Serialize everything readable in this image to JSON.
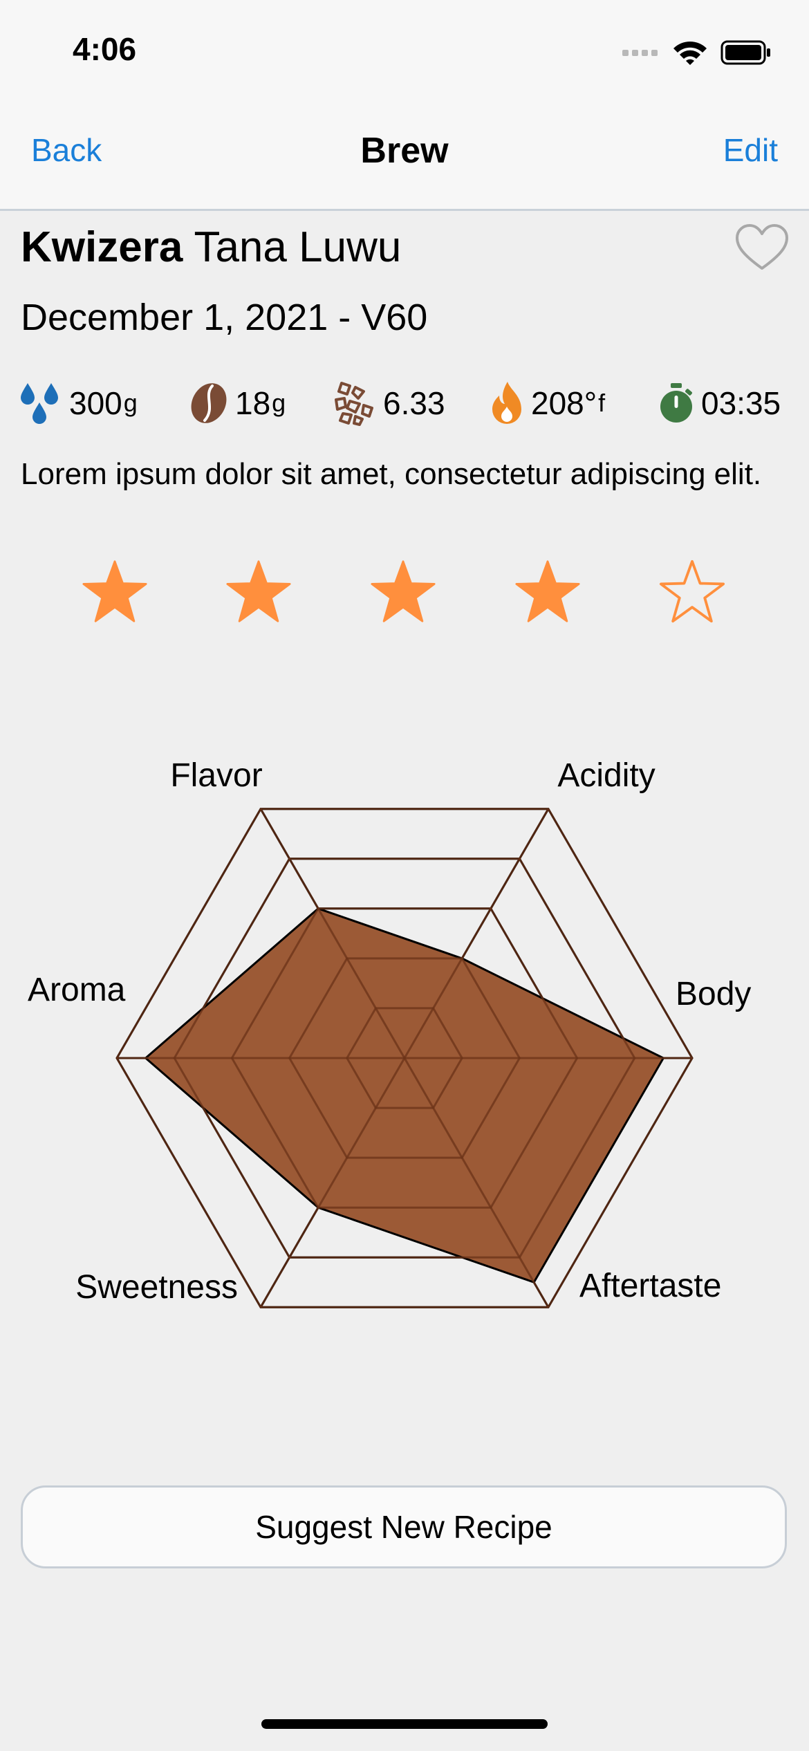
{
  "status_bar": {
    "time": "4:06",
    "icons": [
      "signal-icon",
      "wifi-icon",
      "battery-icon"
    ]
  },
  "nav": {
    "back_label": "Back",
    "title": "Brew",
    "edit_label": "Edit"
  },
  "brew": {
    "roaster": "Kwizera",
    "coffee": "Tana Luwu",
    "date_method": "December 1, 2021 - V60",
    "favorite": false,
    "notes": "Lorem ipsum dolor sit amet, consectetur adipiscing elit."
  },
  "stats": {
    "water": {
      "icon": "water-drops-icon",
      "value": "300",
      "unit": "g"
    },
    "coffee": {
      "icon": "coffee-bean-icon",
      "value": "18",
      "unit": "g"
    },
    "grind": {
      "icon": "grind-icon",
      "value": "6.33"
    },
    "temperature": {
      "icon": "flame-icon",
      "value": "208°",
      "unit": "f"
    },
    "time": {
      "icon": "stopwatch-icon",
      "value": "03:35"
    }
  },
  "rating": {
    "value": 4,
    "max": 5
  },
  "chart_data": {
    "type": "radar",
    "axes": [
      "Flavor",
      "Acidity",
      "Body",
      "Aftertaste",
      "Sweetness",
      "Aroma"
    ],
    "values": [
      3,
      2,
      4.5,
      4.5,
      3,
      4.5
    ],
    "max": 5,
    "fill_color": "#9c5a36"
  },
  "actions": {
    "suggest_label": "Suggest New Recipe"
  },
  "colors": {
    "accent": "#1a7fd9",
    "star": "#ff8f3d",
    "water": "#1e6fb8",
    "bean": "#7a4b35",
    "flame": "#f08a24",
    "stopwatch": "#3f7a43"
  }
}
